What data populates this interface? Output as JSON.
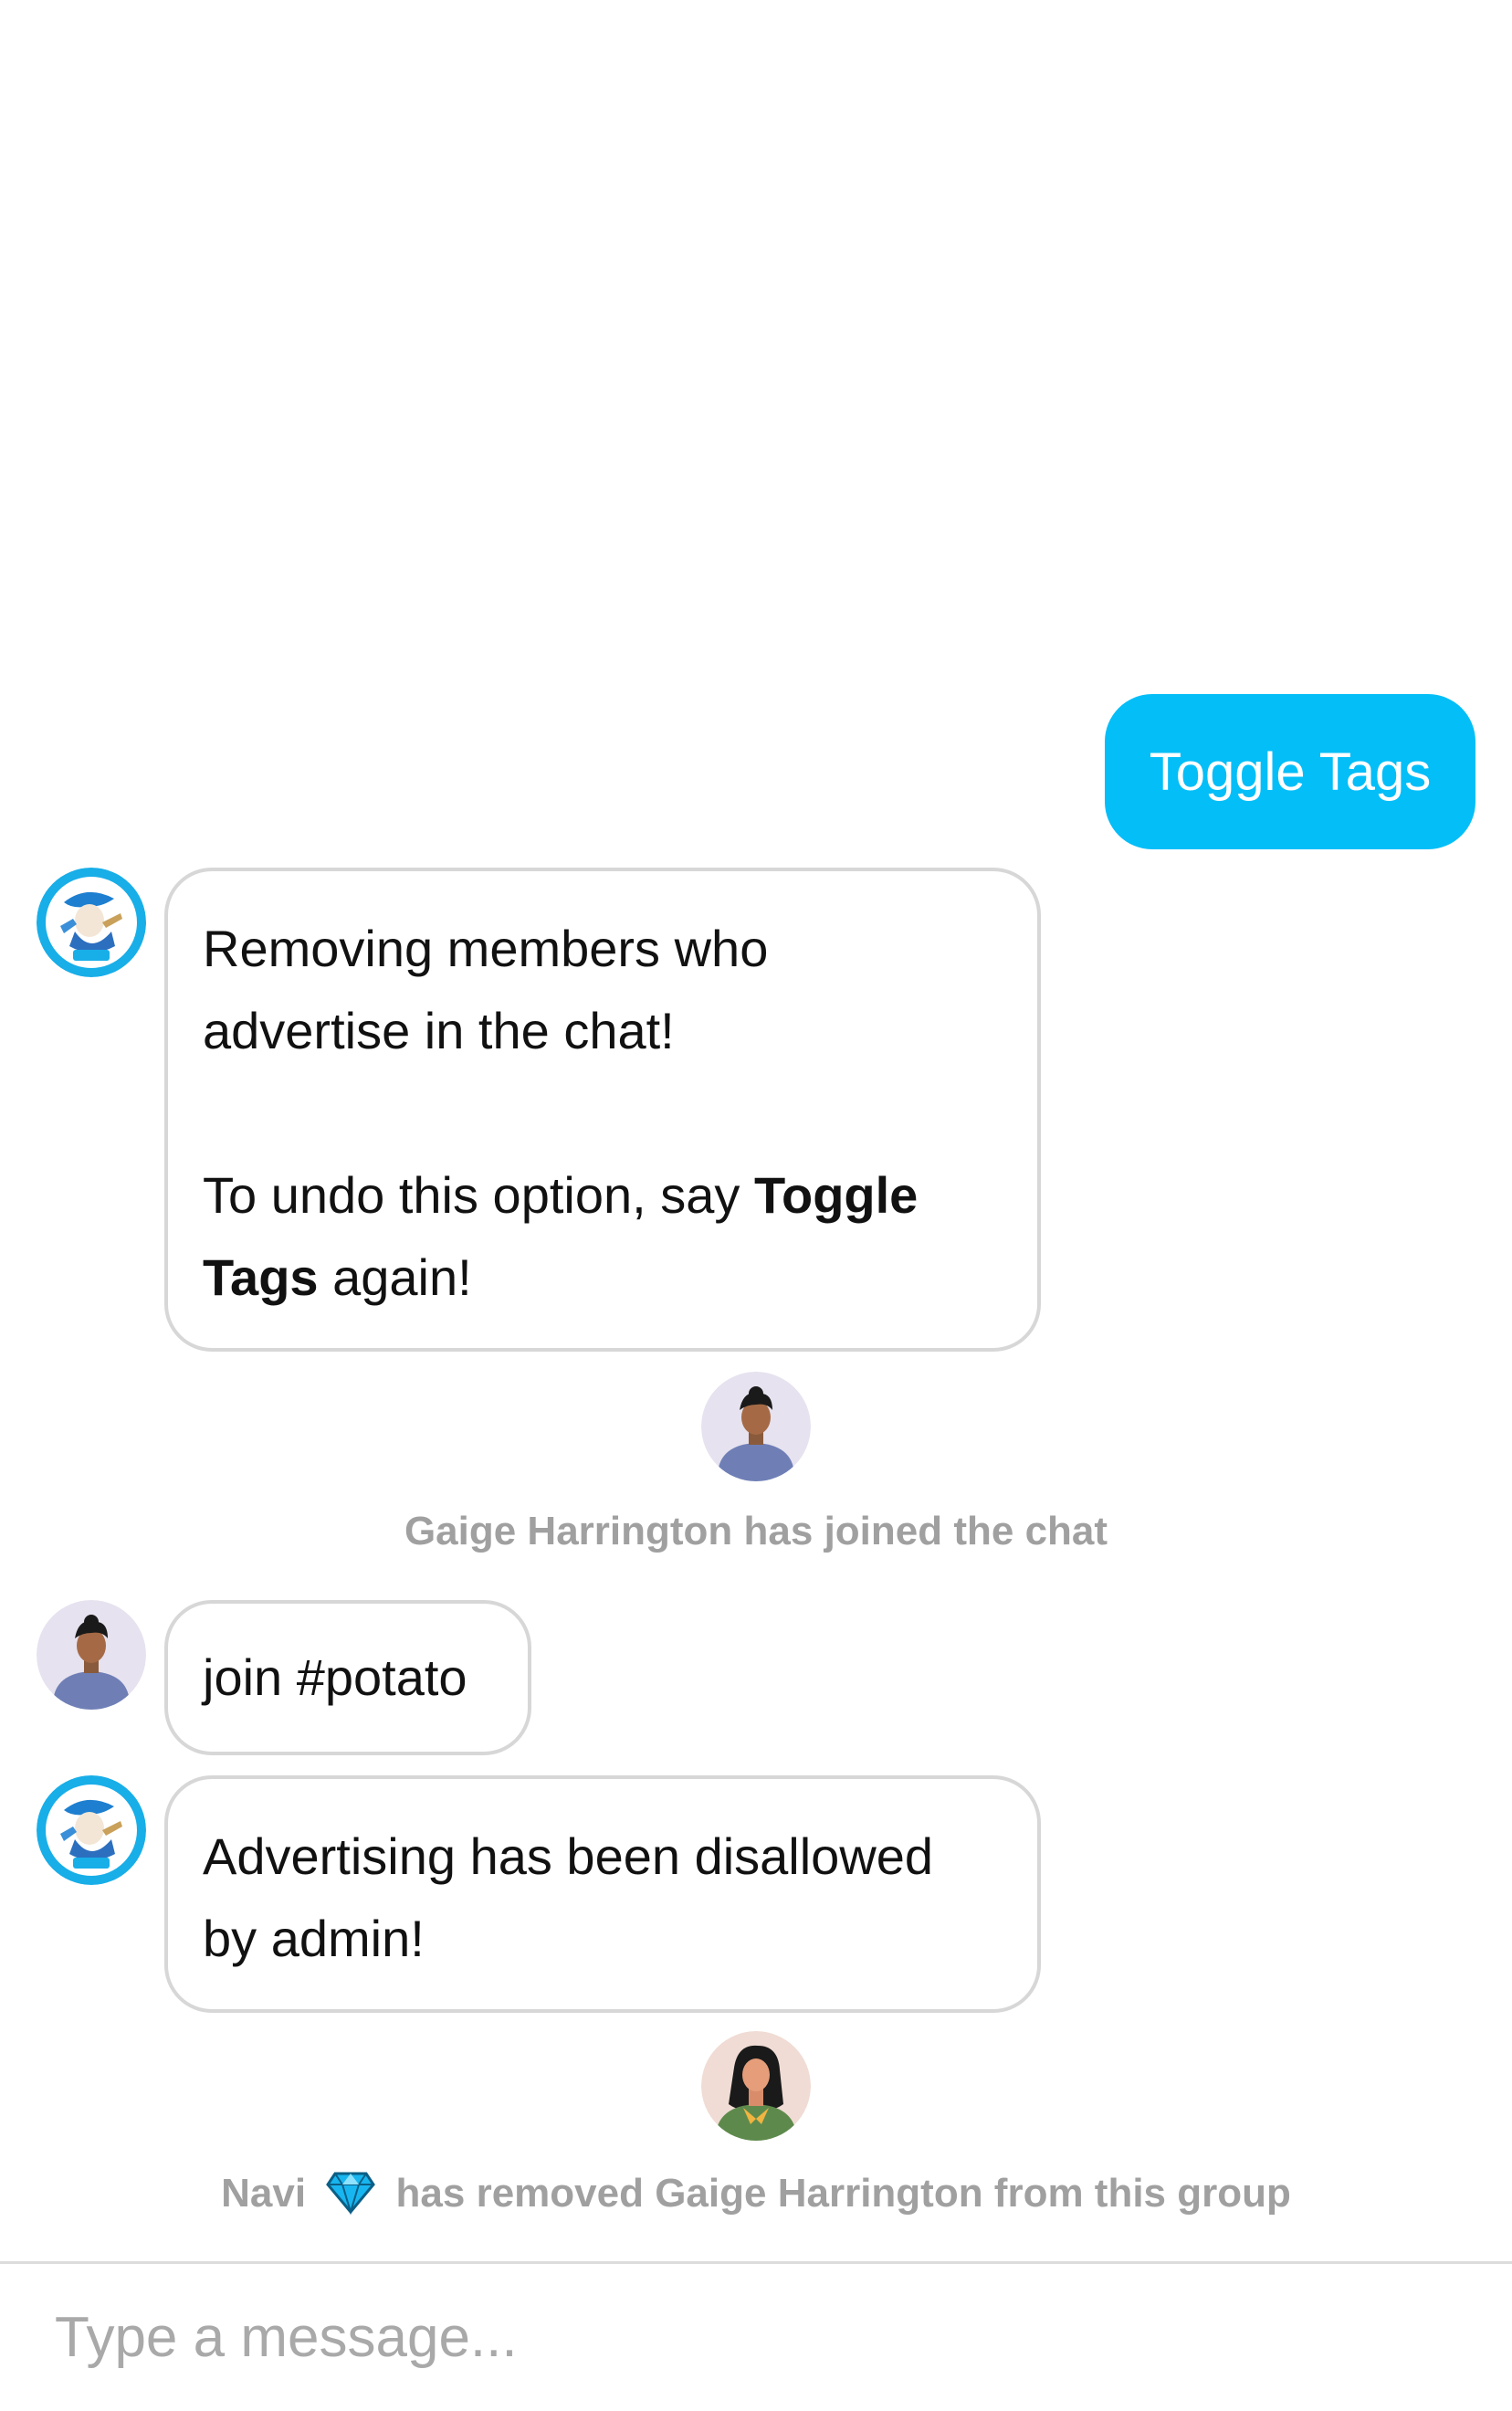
{
  "colors": {
    "accent": "#04bef8",
    "bubble_border": "#d7d7d7",
    "system_text": "#a0a0a0"
  },
  "messages": {
    "outgoing_1": "Toggle Tags",
    "navi_1": {
      "line_1": "Removing members who",
      "line_2": "advertise in the chat!",
      "undo_prefix": "To undo this option, say ",
      "undo_bold_1": "Toggle",
      "undo_bold_2": "Tags",
      "undo_suffix": " again!"
    },
    "join_notice": "Gaige Harrington has joined the chat",
    "user_msg": "join #potato",
    "navi_2": {
      "line_1": "Advertising has been disallowed",
      "line_2": "by admin!"
    },
    "removal_notice": {
      "actor": "Navi",
      "badge_icon": "diamond-icon",
      "text": "has removed Gaige Harrington from this group"
    }
  },
  "avatars": {
    "bot": "navi-bot-avatar",
    "user": "man-avatar",
    "admin": "woman-avatar"
  },
  "composer": {
    "placeholder": "Type a message..."
  }
}
